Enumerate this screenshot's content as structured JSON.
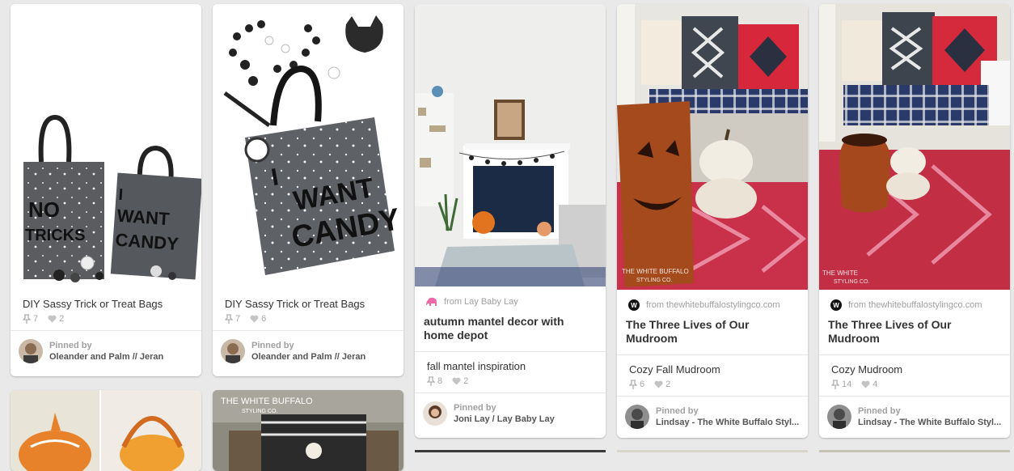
{
  "pins": [
    {
      "caption": "DIY Sassy Trick or Treat Bags",
      "repins": "7",
      "likes": "2",
      "pinned_by_label": "Pinned by",
      "pinner": "Oleander and Palm // Jeran",
      "image_text": [
        "NO",
        "TRICKS",
        "I",
        "WANT",
        "CANDY"
      ]
    },
    {
      "caption": "DIY Sassy Trick or Treat Bags",
      "repins": "7",
      "likes": "6",
      "pinned_by_label": "Pinned by",
      "pinner": "Oleander and Palm // Jeran",
      "image_text": [
        "I",
        "WANT",
        "CANDY"
      ]
    },
    {
      "source": "from Lay Baby Lay",
      "title": "autumn mantel decor with home depot",
      "caption": "fall mantel inspiration",
      "repins": "8",
      "likes": "2",
      "pinned_by_label": "Pinned by",
      "pinner": "Joni Lay / Lay Baby Lay"
    },
    {
      "source": "from thewhitebuffalostylingco.com",
      "source_icon_letter": "W",
      "title": "The Three Lives of Our Mudroom",
      "caption": "Cozy Fall Mudroom",
      "repins": "6",
      "likes": "2",
      "pinned_by_label": "Pinned by",
      "pinner": "Lindsay - The White Buffalo Styl...",
      "watermark": [
        "THE WHITE BUFFALO",
        "STYLING CO."
      ]
    },
    {
      "source": "from thewhitebuffalostylingco.com",
      "source_icon_letter": "W",
      "title": "The Three Lives of Our Mudroom",
      "caption": "Cozy Mudroom",
      "repins": "14",
      "likes": "4",
      "pinned_by_label": "Pinned by",
      "pinner": "Lindsay - The White Buffalo Styl...",
      "watermark": [
        "THE WHITE",
        "STYLING CO."
      ]
    }
  ],
  "bottom_pins": [
    {
      "image": "pumpkin-baskets"
    },
    {
      "image": "outdoor-table",
      "watermark": [
        "THE WHITE BUFFALO",
        "STYLING CO."
      ]
    }
  ],
  "icons": {
    "repin": "pushpin-icon",
    "like": "heart-icon",
    "source_pink": "pink-elephant-icon"
  },
  "colors": {
    "background": "#e9e9e9",
    "card": "#ffffff",
    "meta_gray": "#a7a7a7",
    "title": "#333333"
  }
}
